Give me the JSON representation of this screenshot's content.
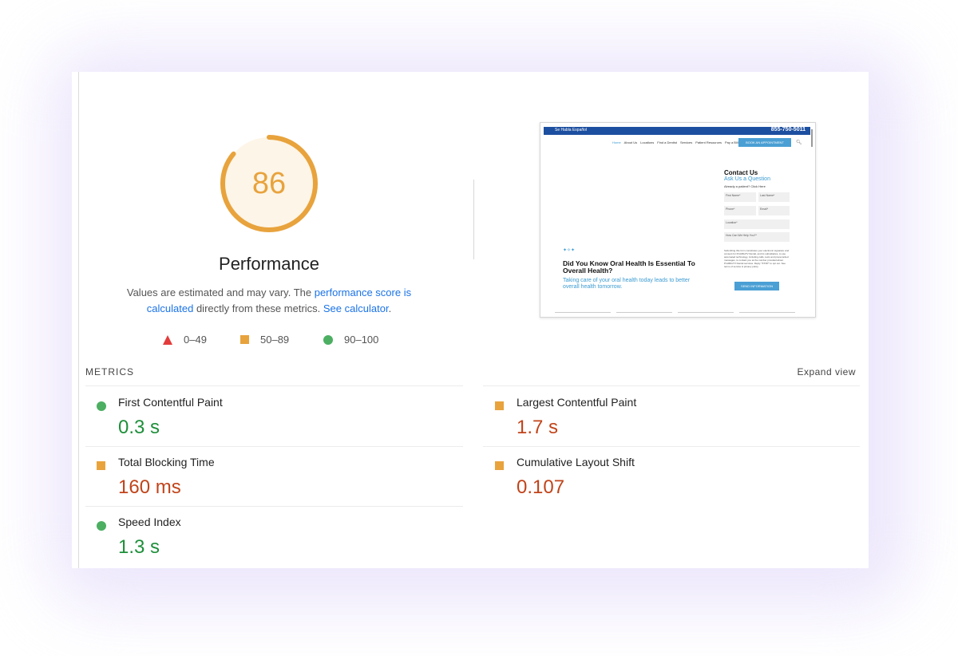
{
  "score": {
    "value": "86",
    "fraction": 0.86,
    "color": "#e8a33d"
  },
  "performance": {
    "title": "Performance",
    "desc_prefix": "Values are estimated and may vary. The ",
    "link_score": "performance score is calculated",
    "desc_middle": " directly from these metrics. ",
    "link_calc": "See calculator",
    "desc_suffix": "."
  },
  "legend": [
    {
      "range": "0–49",
      "shape": "triangle",
      "color": "#e33b3b"
    },
    {
      "range": "50–89",
      "shape": "square",
      "color": "#e8a33d"
    },
    {
      "range": "90–100",
      "shape": "circle",
      "color": "#4caf62"
    }
  ],
  "thumbnail": {
    "lang": "Se Habla Español",
    "phone": "855-750-5011",
    "nav": [
      "Home",
      "About Us",
      "Locations",
      "Find a Dentist",
      "Services",
      "Patient Resources",
      "Pay a Bill"
    ],
    "cta": "BOOK AN APPOINTMENT",
    "contact_title": "Contact Us",
    "ask": "Ask Us a Question",
    "already": "Already a patient? Click Here",
    "fields": [
      "First Name*",
      "Last Name*",
      "Phone*",
      "Email*",
      "Location*",
      "How Can We Help You?*"
    ],
    "small_text": "Submitting this form constitutes your electronic signature and consent for ProMDuTV Dental, and its subsidiaries, to use automated technology, including calls, texts and prerecorded messages, to contact you at the number provided about ProMDuTV Dental services. Reply \"STOP\" to opt out. See terms of service & privacy policy",
    "submit": "SEND INFORMATION",
    "stars": "✦✧✦",
    "headline": "Did You Know Oral Health Is Essential To Overall Health?",
    "sub": "Taking care of your oral health today leads to better overall health tomorrow."
  },
  "metrics": {
    "label": "METRICS",
    "expand": "Expand view",
    "items": [
      {
        "name": "First Contentful Paint",
        "value": "0.3 s",
        "status": "good"
      },
      {
        "name": "Largest Contentful Paint",
        "value": "1.7 s",
        "status": "average"
      },
      {
        "name": "Total Blocking Time",
        "value": "160 ms",
        "status": "average"
      },
      {
        "name": "Cumulative Layout Shift",
        "value": "0.107",
        "status": "average"
      },
      {
        "name": "Speed Index",
        "value": "1.3 s",
        "status": "good"
      }
    ]
  },
  "colors": {
    "good": "#4caf62",
    "average": "#e8a33d",
    "good_text": "#1e8f3a",
    "average_text": "#c0441a",
    "link": "#1a73e8"
  }
}
